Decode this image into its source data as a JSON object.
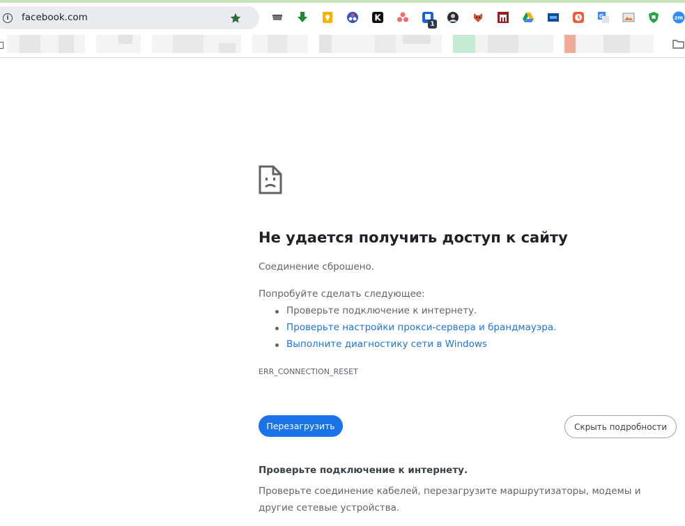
{
  "browser": {
    "url": "facebook.com",
    "accent_strip_color": "#c7e5bd",
    "extensions": [
      {
        "name": "tray-icon",
        "badge": ""
      },
      {
        "name": "download-arrow-icon",
        "badge": ""
      },
      {
        "name": "keep-notes-icon",
        "badge": ""
      },
      {
        "name": "circles-icon",
        "badge": ""
      },
      {
        "name": "k-icon",
        "badge": ""
      },
      {
        "name": "dots-icon",
        "badge": ""
      },
      {
        "name": "p-badge-icon",
        "badge": "1"
      },
      {
        "name": "avatar-ext-icon",
        "badge": ""
      },
      {
        "name": "fox-icon",
        "badge": ""
      },
      {
        "name": "castle-icon",
        "badge": ""
      },
      {
        "name": "drive-icon",
        "badge": ""
      },
      {
        "name": "flag-icon",
        "badge": ""
      },
      {
        "name": "clock-icon",
        "badge": ""
      },
      {
        "name": "translate-icon",
        "badge": ""
      },
      {
        "name": "image-icon",
        "badge": ""
      },
      {
        "name": "shield-icon",
        "badge": ""
      },
      {
        "name": "zoom-icon",
        "badge": ""
      }
    ]
  },
  "error_page": {
    "icon": "sad-page-icon",
    "title": "Не удается получить доступ к сайту",
    "subtitle": "Соединение сброшено.",
    "try_label": "Попробуйте сделать следующее:",
    "suggestions": [
      "Проверьте подключение к интернету.",
      "Проверьте настройки прокси-сервера и брандмауэра.",
      "Выполните диагностику сети в Windows"
    ],
    "error_code": "ERR_CONNECTION_RESET",
    "reload_label": "Перезагрузить",
    "details_label": "Скрыть подробности",
    "details_title": "Проверьте подключение к интернету.",
    "details_body": "Проверьте соединение кабелей, перезагрузите маршрутизаторы, модемы и другие сетевые устройства.",
    "link_color": "#1a73e8",
    "button_color": "#1a73e8"
  }
}
